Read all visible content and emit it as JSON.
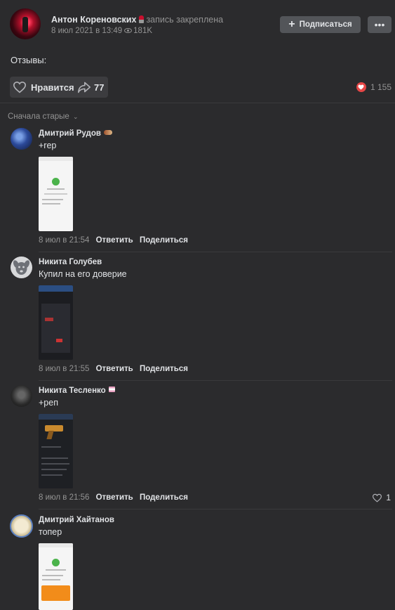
{
  "post": {
    "author": "Антон Кореновских",
    "pinned_label": "запись закреплена",
    "date": "8 июл 2021 в 13:49",
    "views": "181K",
    "subscribe_label": "Подписаться",
    "more_label": "•••",
    "text": "Отзывы:",
    "like_label": "Нравится",
    "share_count": "77",
    "reactions_count": "1 155"
  },
  "comments_sort": "Сначала старые",
  "comments": [
    {
      "name": "Дмитрий Рудов",
      "text": "+rep",
      "time": "8 июл в 21:54",
      "reply": "Ответить",
      "share": "Поделиться",
      "likes": ""
    },
    {
      "name": "Никита Голубев",
      "text": "Купил на его доверие",
      "time": "8 июл в 21:55",
      "reply": "Ответить",
      "share": "Поделиться",
      "likes": ""
    },
    {
      "name": "Никита Тесленко",
      "text": "+реп",
      "time": "8 июл в 21:56",
      "reply": "Ответить",
      "share": "Поделиться",
      "likes": "1"
    },
    {
      "name": "Дмитрий Хайтанов",
      "text": "топер"
    }
  ],
  "colors": {
    "background": "#2b2b2d",
    "accent_like": "#e64646",
    "button": "#535559"
  }
}
